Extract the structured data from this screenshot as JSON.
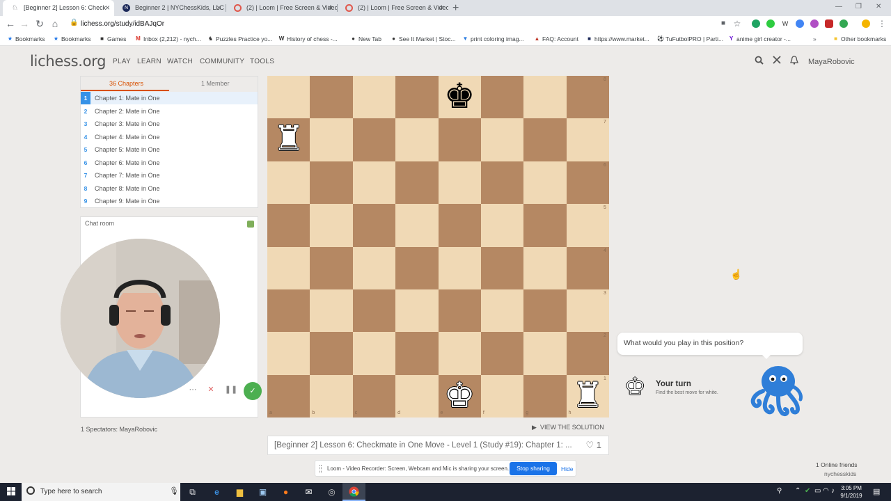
{
  "browser": {
    "tabs": [
      {
        "title": "[Beginner 2] Lesson 6: Check",
        "active": true
      },
      {
        "title": "Beginner 2 | NYChessKids, LLC",
        "active": false
      },
      {
        "title": "(2) | Loom | Free Screen & Video",
        "active": false
      },
      {
        "title": "(2) | Loom | Free Screen & Video",
        "active": false
      }
    ],
    "url": "lichess.org/study/idBAJqOr",
    "bookmarks": [
      "Bookmarks",
      "Bookmarks",
      "Games",
      "Inbox (2,212) - nych...",
      "Puzzles Practice yo...",
      "History of chess -...",
      "New Tab",
      "See It Market | Stoc...",
      "print coloring imag...",
      "FAQ: Account",
      "https://www.market...",
      "TuFutbolPRO | Parti...",
      "anime girl creator -...",
      "Other bookmarks"
    ]
  },
  "site": {
    "logo": "lichess.org",
    "nav": [
      "PLAY",
      "LEARN",
      "WATCH",
      "COMMUNITY",
      "TOOLS"
    ],
    "username": "MayaRobovic"
  },
  "study": {
    "tabs": {
      "chapters": "36 Chapters",
      "members": "1 Member"
    },
    "chapters": [
      {
        "num": "1",
        "title": "Chapter 1: Mate in One"
      },
      {
        "num": "2",
        "title": "Chapter 2: Mate in One"
      },
      {
        "num": "3",
        "title": "Chapter 3: Mate in One"
      },
      {
        "num": "4",
        "title": "Chapter 4: Mate in One"
      },
      {
        "num": "5",
        "title": "Chapter 5: Mate in One"
      },
      {
        "num": "6",
        "title": "Chapter 6: Mate in One"
      },
      {
        "num": "7",
        "title": "Chapter 7: Mate in One"
      },
      {
        "num": "8",
        "title": "Chapter 8: Mate in One"
      },
      {
        "num": "9",
        "title": "Chapter 9: Mate in One"
      }
    ],
    "chat_title": "Chat room",
    "spectators": "1 Spectators: MayaRobovic",
    "view_solution": "VIEW THE SOLUTION",
    "title": "[Beginner 2] Lesson 6: Checkmate in One Move - Level 1 (Study #19): Chapter 1: ...",
    "likes": "1"
  },
  "board": {
    "files": [
      "a",
      "b",
      "c",
      "d",
      "e",
      "f",
      "g",
      "h"
    ],
    "ranks": [
      "8",
      "7",
      "6",
      "5",
      "4",
      "3",
      "2",
      "1"
    ],
    "pieces": [
      {
        "square": "e8",
        "piece": "king",
        "color": "black"
      },
      {
        "square": "a7",
        "piece": "rook",
        "color": "white"
      },
      {
        "square": "e1",
        "piece": "king",
        "color": "white"
      },
      {
        "square": "h1",
        "piece": "rook",
        "color": "white"
      }
    ]
  },
  "coach": {
    "question": "What would you play in this position?",
    "turn_title": "Your turn",
    "turn_sub": "Find the best move for white."
  },
  "friends": {
    "count_label": "1 Online friends",
    "name": "nychesskids"
  },
  "loom": {
    "message": "Loom - Video Recorder: Screen, Webcam and Mic is sharing your screen.",
    "stop": "Stop sharing",
    "hide": "Hide"
  },
  "taskbar": {
    "search_placeholder": "Type here to search",
    "time": "3:05 PM",
    "date": "9/1/2019"
  },
  "colors": {
    "accent": "#d85000",
    "chapter_blue": "#3692e7",
    "board_light": "#f0d9b5",
    "board_dark": "#b58863"
  }
}
